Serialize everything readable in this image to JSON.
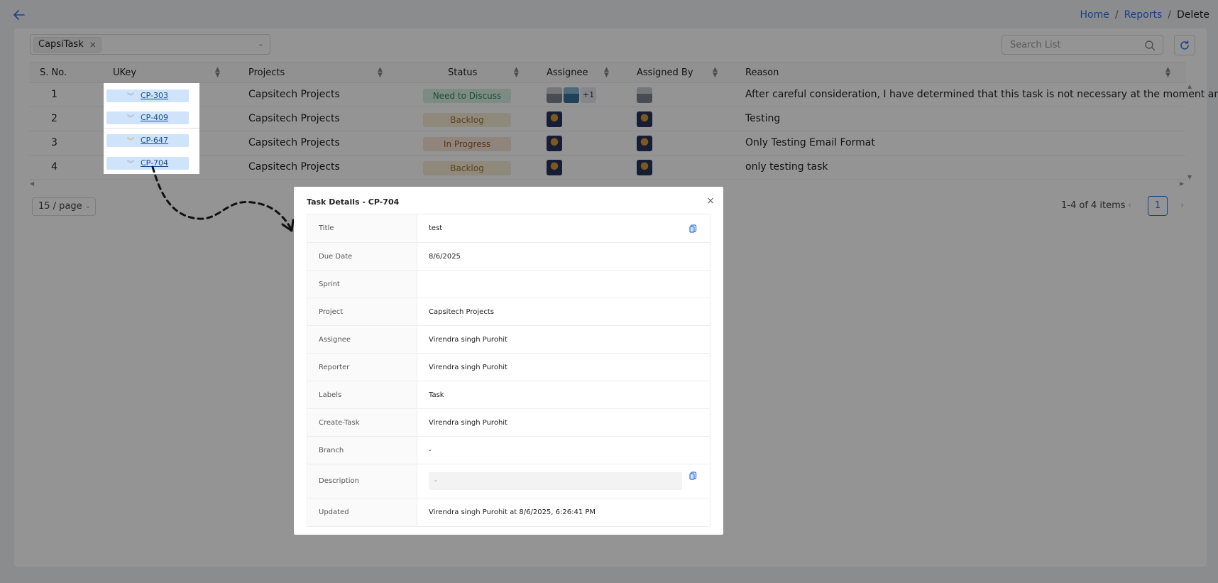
{
  "breadcrumb": {
    "home": "Home",
    "reports": "Reports",
    "current": "Delete",
    "sep": "/"
  },
  "filter": {
    "tag": "CapsiTask",
    "tag_close": "×",
    "chevron": "⌄"
  },
  "search": {
    "placeholder": "Search List"
  },
  "table": {
    "headers": {
      "sno": "S. No.",
      "ukey": "UKey",
      "projects": "Projects",
      "status": "Status",
      "assignee": "Assignee",
      "assigned_by": "Assigned By",
      "reason": "Reason"
    },
    "rows": [
      {
        "sno": "1",
        "ukey": "CP-303",
        "project": "Capsitech Projects",
        "status": "Need to Discuss",
        "assignee_extra": "+1",
        "reason": "After careful consideration, I have determined that this task is not necessary at the moment and ..."
      },
      {
        "sno": "2",
        "ukey": "CP-409",
        "project": "Capsitech Projects",
        "status": "Backlog",
        "reason": "Testing"
      },
      {
        "sno": "3",
        "ukey": "CP-647",
        "project": "Capsitech Projects",
        "status": "In Progress",
        "reason": "Only Testing Email Format"
      },
      {
        "sno": "4",
        "ukey": "CP-704",
        "project": "Capsitech Projects",
        "status": "Backlog",
        "reason": "only testing task"
      }
    ]
  },
  "pagination": {
    "page_size": "15 / page",
    "info": "1-4 of 4 items",
    "current_page": "1",
    "prev": "‹",
    "next": "›"
  },
  "modal": {
    "title": "Task Details - CP-704",
    "close": "×",
    "fields": [
      {
        "label": "Title",
        "value": "test"
      },
      {
        "label": "Due Date",
        "value": "8/6/2025"
      },
      {
        "label": "Sprint",
        "value": ""
      },
      {
        "label": "Project",
        "value": "Capsitech Projects"
      },
      {
        "label": "Assignee",
        "value": "Virendra singh Purohit"
      },
      {
        "label": "Reporter",
        "value": "Virendra singh Purohit"
      },
      {
        "label": "Labels",
        "value": "Task"
      },
      {
        "label": "Create-Task",
        "value": "Virendra singh Purohit"
      },
      {
        "label": "Branch",
        "value": "-"
      },
      {
        "label": "Description",
        "value": "-"
      },
      {
        "label": "Updated",
        "value": "Virendra singh Purohit at 8/6/2025, 6:26:41 PM"
      }
    ]
  },
  "colors": {
    "accent": "#2f6fe4",
    "need_to_discuss": "#d7f0e4",
    "backlog": "#f6ecd4",
    "in_progress": "#f6e6d6"
  },
  "icons": {
    "back": "arrow-left-icon",
    "search": "search-icon",
    "refresh": "refresh-icon",
    "copy": "copy-icon",
    "sort": "sort-icon",
    "close": "close-icon"
  }
}
